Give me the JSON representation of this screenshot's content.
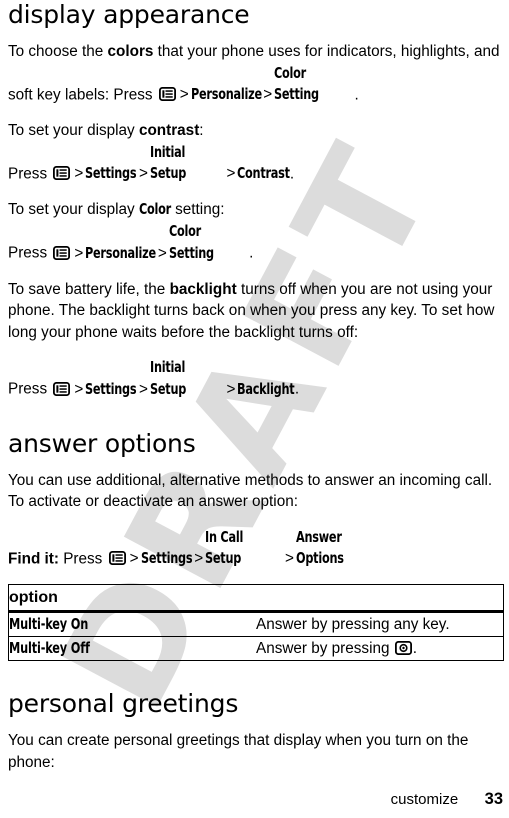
{
  "document": {
    "page_number": "33",
    "footer_label": "customize",
    "watermark_text": "DRAFT"
  },
  "sections": [
    {
      "heading": "display appearance",
      "paragraphs": [
        {
          "kind": "rich",
          "parts": [
            {
              "t": "text",
              "v": "To choose the "
            },
            {
              "t": "bold",
              "v": "colors"
            },
            {
              "t": "text",
              "v": " that your phone uses for indicators, highlights, and soft key labels: Press "
            },
            {
              "t": "icon",
              "v": "menu-key-icon"
            },
            {
              "t": "gt",
              "v": ">"
            },
            {
              "t": "cond",
              "v": "Personalize"
            },
            {
              "t": "gt",
              "v": ">"
            },
            {
              "t": "cond",
              "v": "Color Setting"
            },
            {
              "t": "text",
              "v": "."
            }
          ]
        },
        {
          "kind": "rich",
          "parts": [
            {
              "t": "text",
              "v": "To set your display "
            },
            {
              "t": "bold",
              "v": "contrast"
            },
            {
              "t": "text",
              "v": ":"
            }
          ]
        },
        {
          "kind": "rich",
          "parts": [
            {
              "t": "text",
              "v": "Press "
            },
            {
              "t": "icon",
              "v": "menu-key-icon"
            },
            {
              "t": "gt",
              "v": ">"
            },
            {
              "t": "cond",
              "v": "Settings"
            },
            {
              "t": "gt",
              "v": ">"
            },
            {
              "t": "cond",
              "v": "Initial Setup"
            },
            {
              "t": "gt",
              "v": ">"
            },
            {
              "t": "cond",
              "v": "Contrast"
            },
            {
              "t": "text",
              "v": "."
            }
          ]
        },
        {
          "kind": "rich",
          "parts": [
            {
              "t": "text",
              "v": "To set your display "
            },
            {
              "t": "cond",
              "v": "Color"
            },
            {
              "t": "text",
              "v": " setting:"
            }
          ]
        },
        {
          "kind": "rich",
          "parts": [
            {
              "t": "text",
              "v": "Press "
            },
            {
              "t": "icon",
              "v": "menu-key-icon"
            },
            {
              "t": "gt",
              "v": ">"
            },
            {
              "t": "cond",
              "v": "Personalize"
            },
            {
              "t": "gt",
              "v": ">"
            },
            {
              "t": "cond",
              "v": "Color Setting"
            },
            {
              "t": "text",
              "v": "."
            }
          ]
        },
        {
          "kind": "rich",
          "parts": [
            {
              "t": "text",
              "v": "To save battery life, the "
            },
            {
              "t": "bold",
              "v": "backlight"
            },
            {
              "t": "text",
              "v": " turns off when you are not using your phone. The backlight turns back on when you press any key. To set how long your phone waits before the backlight turns off:"
            }
          ]
        },
        {
          "kind": "rich",
          "parts": [
            {
              "t": "text",
              "v": "Press "
            },
            {
              "t": "icon",
              "v": "menu-key-icon"
            },
            {
              "t": "gt",
              "v": ">"
            },
            {
              "t": "cond",
              "v": "Settings"
            },
            {
              "t": "gt",
              "v": ">"
            },
            {
              "t": "cond",
              "v": "Initial Setup"
            },
            {
              "t": "gt",
              "v": ">"
            },
            {
              "t": "cond",
              "v": "Backlight"
            },
            {
              "t": "text",
              "v": "."
            }
          ]
        }
      ]
    },
    {
      "heading": "answer options",
      "paragraphs": [
        {
          "kind": "rich",
          "parts": [
            {
              "t": "text",
              "v": "You can use additional, alternative methods to answer an incoming call. To activate or deactivate an answer option:"
            }
          ]
        },
        {
          "kind": "rich",
          "parts": [
            {
              "t": "bold",
              "v": "Find it:"
            },
            {
              "t": "text",
              "v": " Press "
            },
            {
              "t": "icon",
              "v": "menu-key-icon"
            },
            {
              "t": "gt",
              "v": ">"
            },
            {
              "t": "cond",
              "v": "Settings"
            },
            {
              "t": "gt",
              "v": ">"
            },
            {
              "t": "cond",
              "v": "In Call Setup"
            },
            {
              "t": "gt",
              "v": ">"
            },
            {
              "t": "cond",
              "v": "Answer Options"
            }
          ]
        }
      ],
      "table": {
        "header": "option",
        "rows": [
          {
            "label": "Multi-key On",
            "description_parts": [
              {
                "t": "text",
                "v": "Answer by pressing any key."
              }
            ]
          },
          {
            "label": "Multi-key Off",
            "description_parts": [
              {
                "t": "text",
                "v": "Answer by pressing "
              },
              {
                "t": "icon",
                "v": "send-key-icon"
              },
              {
                "t": "text",
                "v": "."
              }
            ]
          }
        ]
      }
    },
    {
      "heading": "personal greetings",
      "paragraphs": [
        {
          "kind": "rich",
          "parts": [
            {
              "t": "text",
              "v": "You can create personal greetings that display when you turn on the phone:"
            }
          ]
        }
      ]
    }
  ]
}
